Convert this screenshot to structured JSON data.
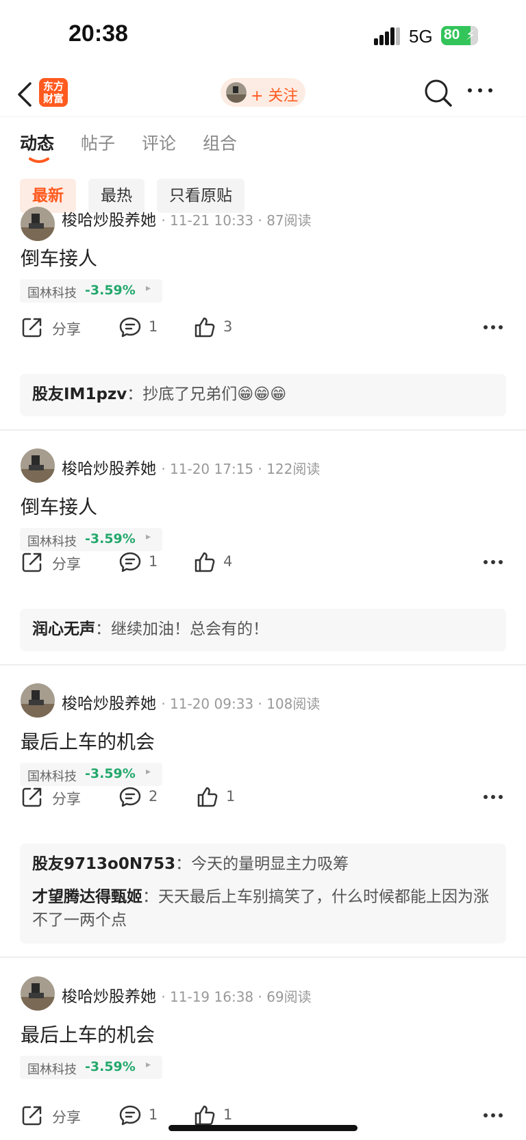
{
  "status": {
    "time": "20:38",
    "network": "5G",
    "battery": "80",
    "battery_level": 0.8
  },
  "nav": {
    "logo_line1": "东方",
    "logo_line2": "财富",
    "follow_label": "+ 关注",
    "icons": [
      "back-icon",
      "search-icon",
      "more-icon"
    ]
  },
  "tabs": [
    "动态",
    "帖子",
    "评论",
    "组合"
  ],
  "filters": [
    "最新",
    "最热",
    "只看原贴"
  ],
  "accent_color": "#ff5a1f",
  "stock_color": "#23a86b",
  "posts": [
    {
      "author": "梭哈炒股养她",
      "meta": "· 11-21 10:33 · 87阅读",
      "title": "倒车接人",
      "stock": "国林科技",
      "change": "-3.59%",
      "share": "分享",
      "comments": "1",
      "likes": "3",
      "replies": [
        {
          "user": "股友IM1pzv",
          "sep": "：",
          "text": "抄底了兄弟们😁😁😁"
        }
      ]
    },
    {
      "author": "梭哈炒股养她",
      "meta": "· 11-20 17:15 · 122阅读",
      "title": "倒车接人",
      "stock": "国林科技",
      "change": "-3.59%",
      "share": "分享",
      "comments": "1",
      "likes": "4",
      "replies": [
        {
          "user": "润心无声",
          "sep": "：",
          "text": "继续加油！总会有的！"
        }
      ]
    },
    {
      "author": "梭哈炒股养她",
      "meta": "· 11-20 09:33 · 108阅读",
      "title": "最后上车的机会",
      "stock": "国林科技",
      "change": "-3.59%",
      "share": "分享",
      "comments": "2",
      "likes": "1",
      "replies": [
        {
          "user": "股友9713o0N753",
          "sep": "：",
          "text": "今天的量明显主力吸筹"
        },
        {
          "user": "才望腾达得甄姬",
          "sep": "：",
          "text": "天天最后上车别搞笑了，什么时候都能上因为涨不了一两个点"
        }
      ]
    },
    {
      "author": "梭哈炒股养她",
      "meta": "· 11-19 16:38 · 69阅读",
      "title": "最后上车的机会",
      "stock": "国林科技",
      "change": "-3.59%",
      "share": "分享",
      "comments": "1",
      "likes": "1",
      "replies": []
    }
  ]
}
